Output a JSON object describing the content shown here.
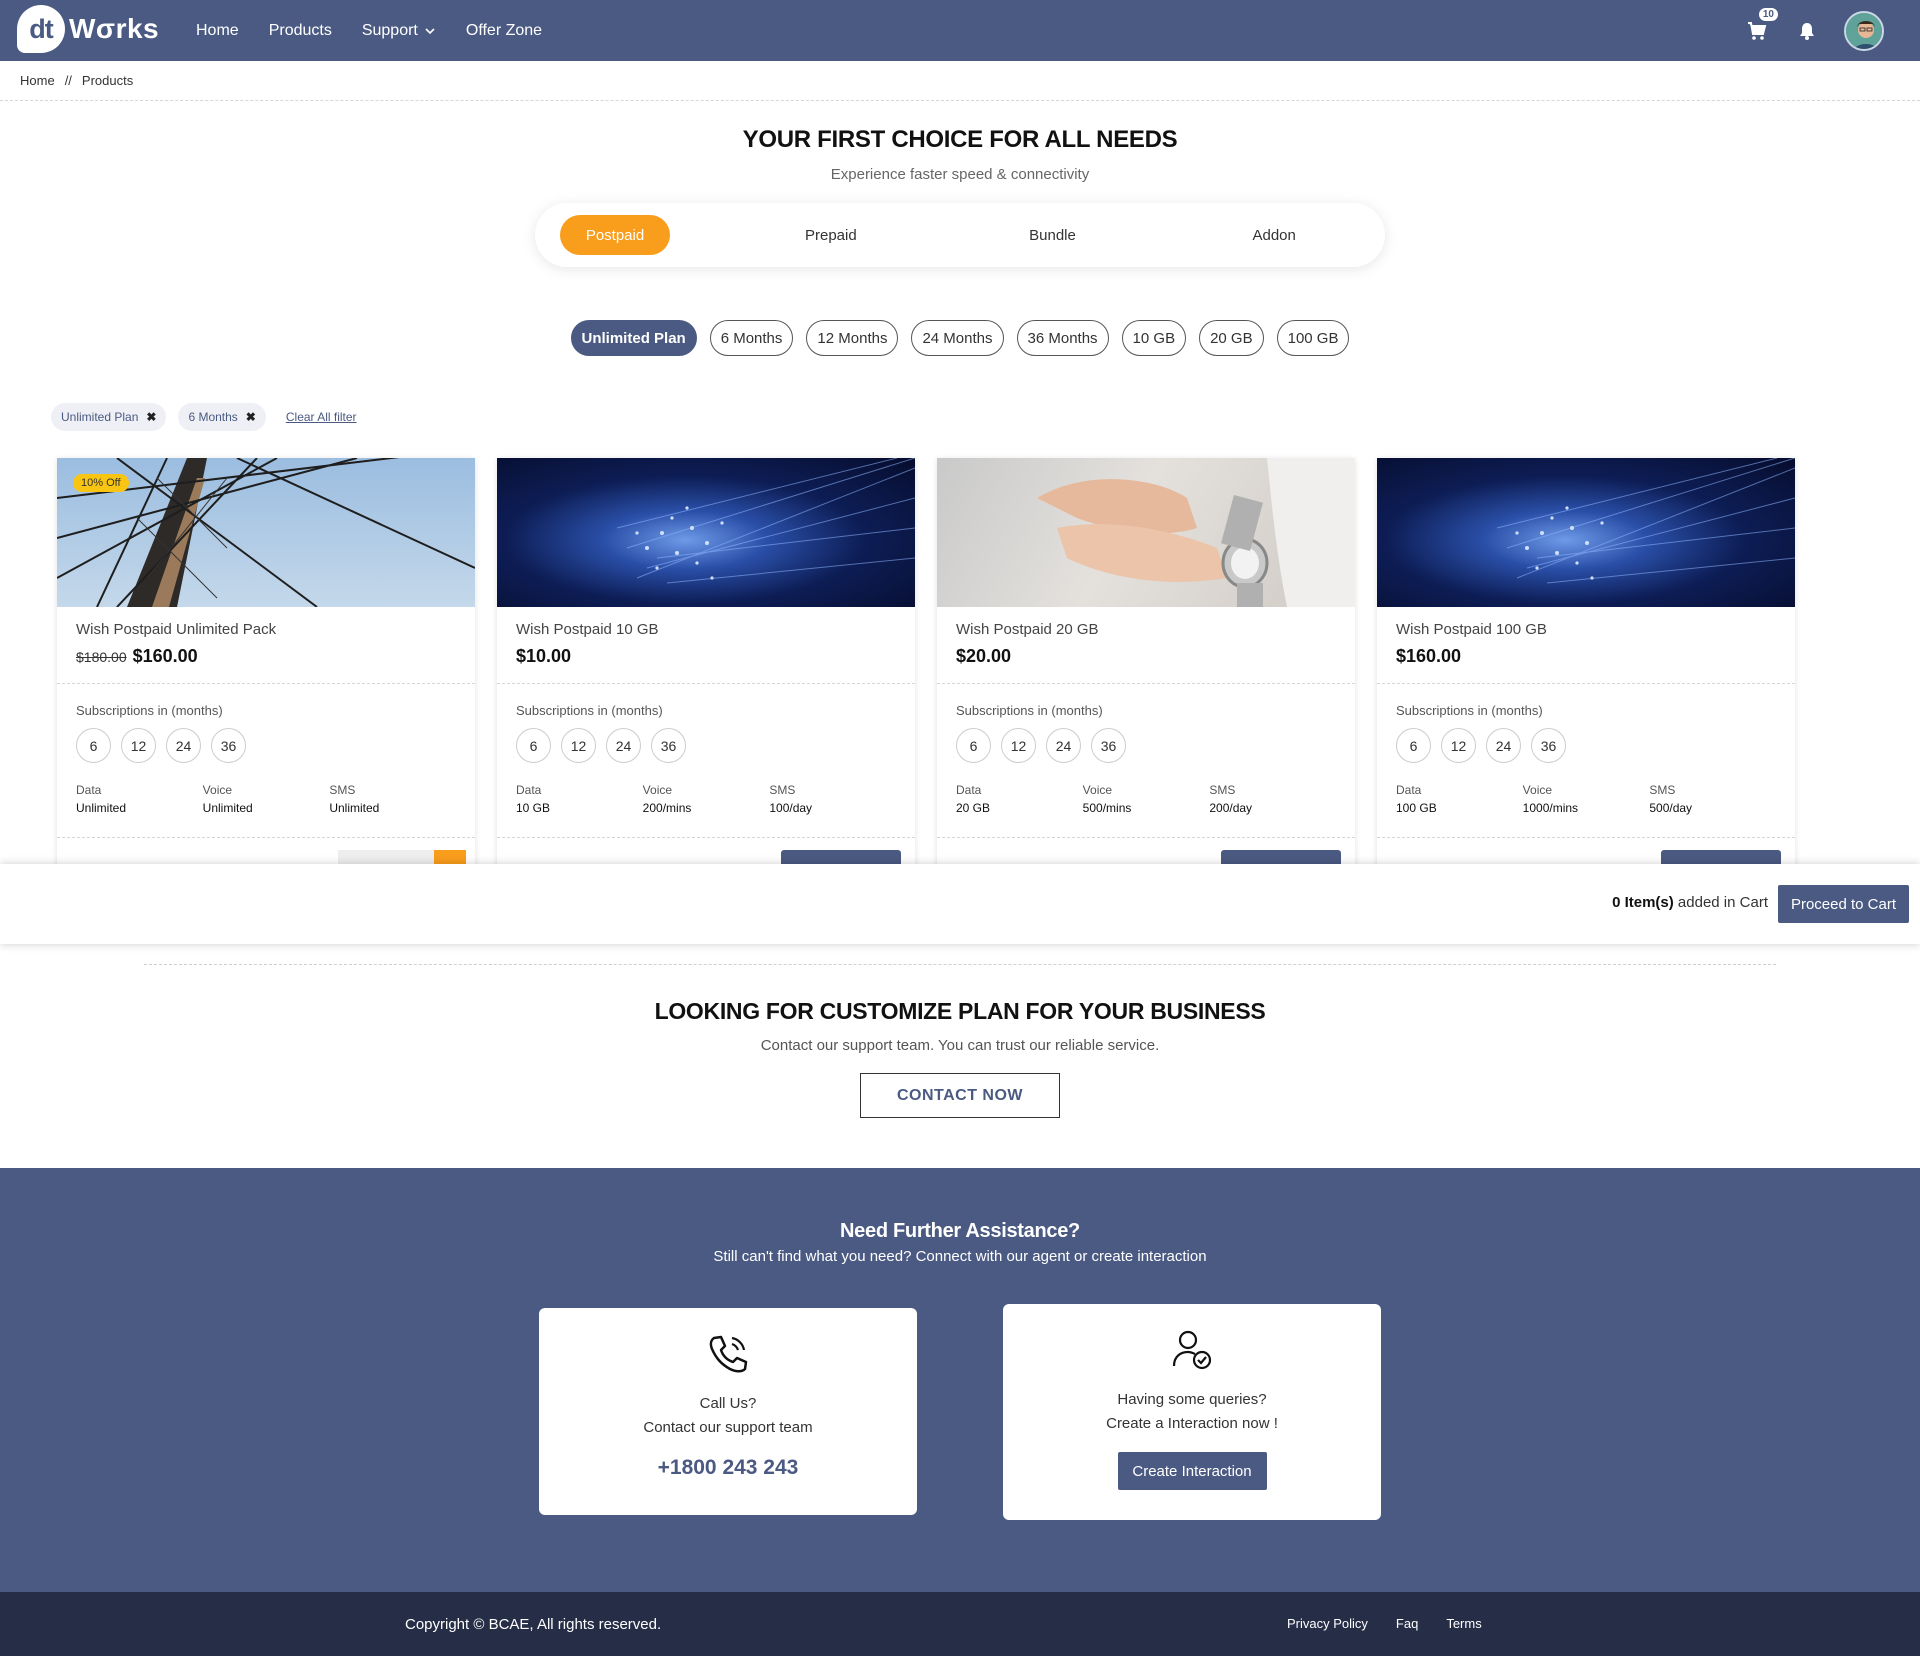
{
  "nav": {
    "logo_badge": "dt",
    "logo_text": "Wσrks",
    "links": [
      {
        "label": "Home"
      },
      {
        "label": "Products"
      },
      {
        "label": "Support"
      },
      {
        "label": "Offer Zone"
      }
    ],
    "cart_count": "10",
    "icons": [
      "cart-icon",
      "bell-icon",
      "chevron-down-icon"
    ]
  },
  "breadcrumb": {
    "items": [
      "Home",
      "//",
      "Products"
    ]
  },
  "hero": {
    "title": "YOUR FIRST CHOICE FOR ALL NEEDS",
    "subtitle": "Experience faster speed & connectivity"
  },
  "type_tabs": [
    "Postpaid",
    "Prepaid",
    "Bundle",
    "Addon"
  ],
  "plan_filters": [
    "Unlimited Plan",
    "6 Months",
    "12 Months",
    "24 Months",
    "36 Months",
    "10 GB",
    "20 GB",
    "100 GB"
  ],
  "active_filters": {
    "chips": [
      "Unlimited Plan",
      "6 Months"
    ],
    "clear_label": "Clear All filter"
  },
  "cards": [
    {
      "badge": "10% Off",
      "name": "Wish Postpaid Unlimited Pack",
      "old_price": "$180.00",
      "price": "$160.00",
      "subs_label": "Subscriptions in (months)",
      "subs": [
        "6",
        "12",
        "24",
        "36"
      ],
      "specs": [
        {
          "k": "Data",
          "v": "Unlimited"
        },
        {
          "k": "Voice",
          "v": "Unlimited"
        },
        {
          "k": "SMS",
          "v": "Unlimited"
        }
      ]
    },
    {
      "name": "Wish Postpaid 10 GB",
      "price": "$10.00",
      "subs_label": "Subscriptions in (months)",
      "subs": [
        "6",
        "12",
        "24",
        "36"
      ],
      "specs": [
        {
          "k": "Data",
          "v": "10 GB"
        },
        {
          "k": "Voice",
          "v": "200/mins"
        },
        {
          "k": "SMS",
          "v": "100/day"
        }
      ]
    },
    {
      "name": "Wish Postpaid 20 GB",
      "price": "$20.00",
      "subs_label": "Subscriptions in (months)",
      "subs": [
        "6",
        "12",
        "24",
        "36"
      ],
      "specs": [
        {
          "k": "Data",
          "v": "20 GB"
        },
        {
          "k": "Voice",
          "v": "500/mins"
        },
        {
          "k": "SMS",
          "v": "200/day"
        }
      ]
    },
    {
      "name": "Wish Postpaid 100 GB",
      "price": "$160.00",
      "subs_label": "Subscriptions in (months)",
      "subs": [
        "6",
        "12",
        "24",
        "36"
      ],
      "specs": [
        {
          "k": "Data",
          "v": "100 GB"
        },
        {
          "k": "Voice",
          "v": "1000/mins"
        },
        {
          "k": "SMS",
          "v": "500/day"
        }
      ]
    }
  ],
  "cart_bar": {
    "count": "0 Item(s)",
    "suffix": " added in Cart",
    "proceed_label": "Proceed to Cart"
  },
  "business": {
    "title": "LOOKING FOR CUSTOMIZE PLAN FOR YOUR BUSINESS",
    "subtitle": "Contact our support team. You can trust our reliable service.",
    "button": "CONTACT NOW"
  },
  "assist": {
    "title": "Need Further Assistance?",
    "subtitle": "Still can't find what you need? Connect with our agent or create interaction",
    "call": {
      "line1": "Call Us?",
      "line2": "Contact our support team",
      "phone": "+1800 243 243"
    },
    "interaction": {
      "line1": "Having some queries?",
      "line2": "Create a Interaction now !",
      "button": "Create Interaction"
    }
  },
  "footer": {
    "copyright": "Copyright © BCAE, All rights reserved.",
    "links": [
      "Privacy Policy",
      "Faq",
      "Terms"
    ]
  },
  "colors": {
    "primary": "#4b5a82",
    "accent": "#f99d1c",
    "footer": "#252d47",
    "badge": "#f8c512"
  }
}
